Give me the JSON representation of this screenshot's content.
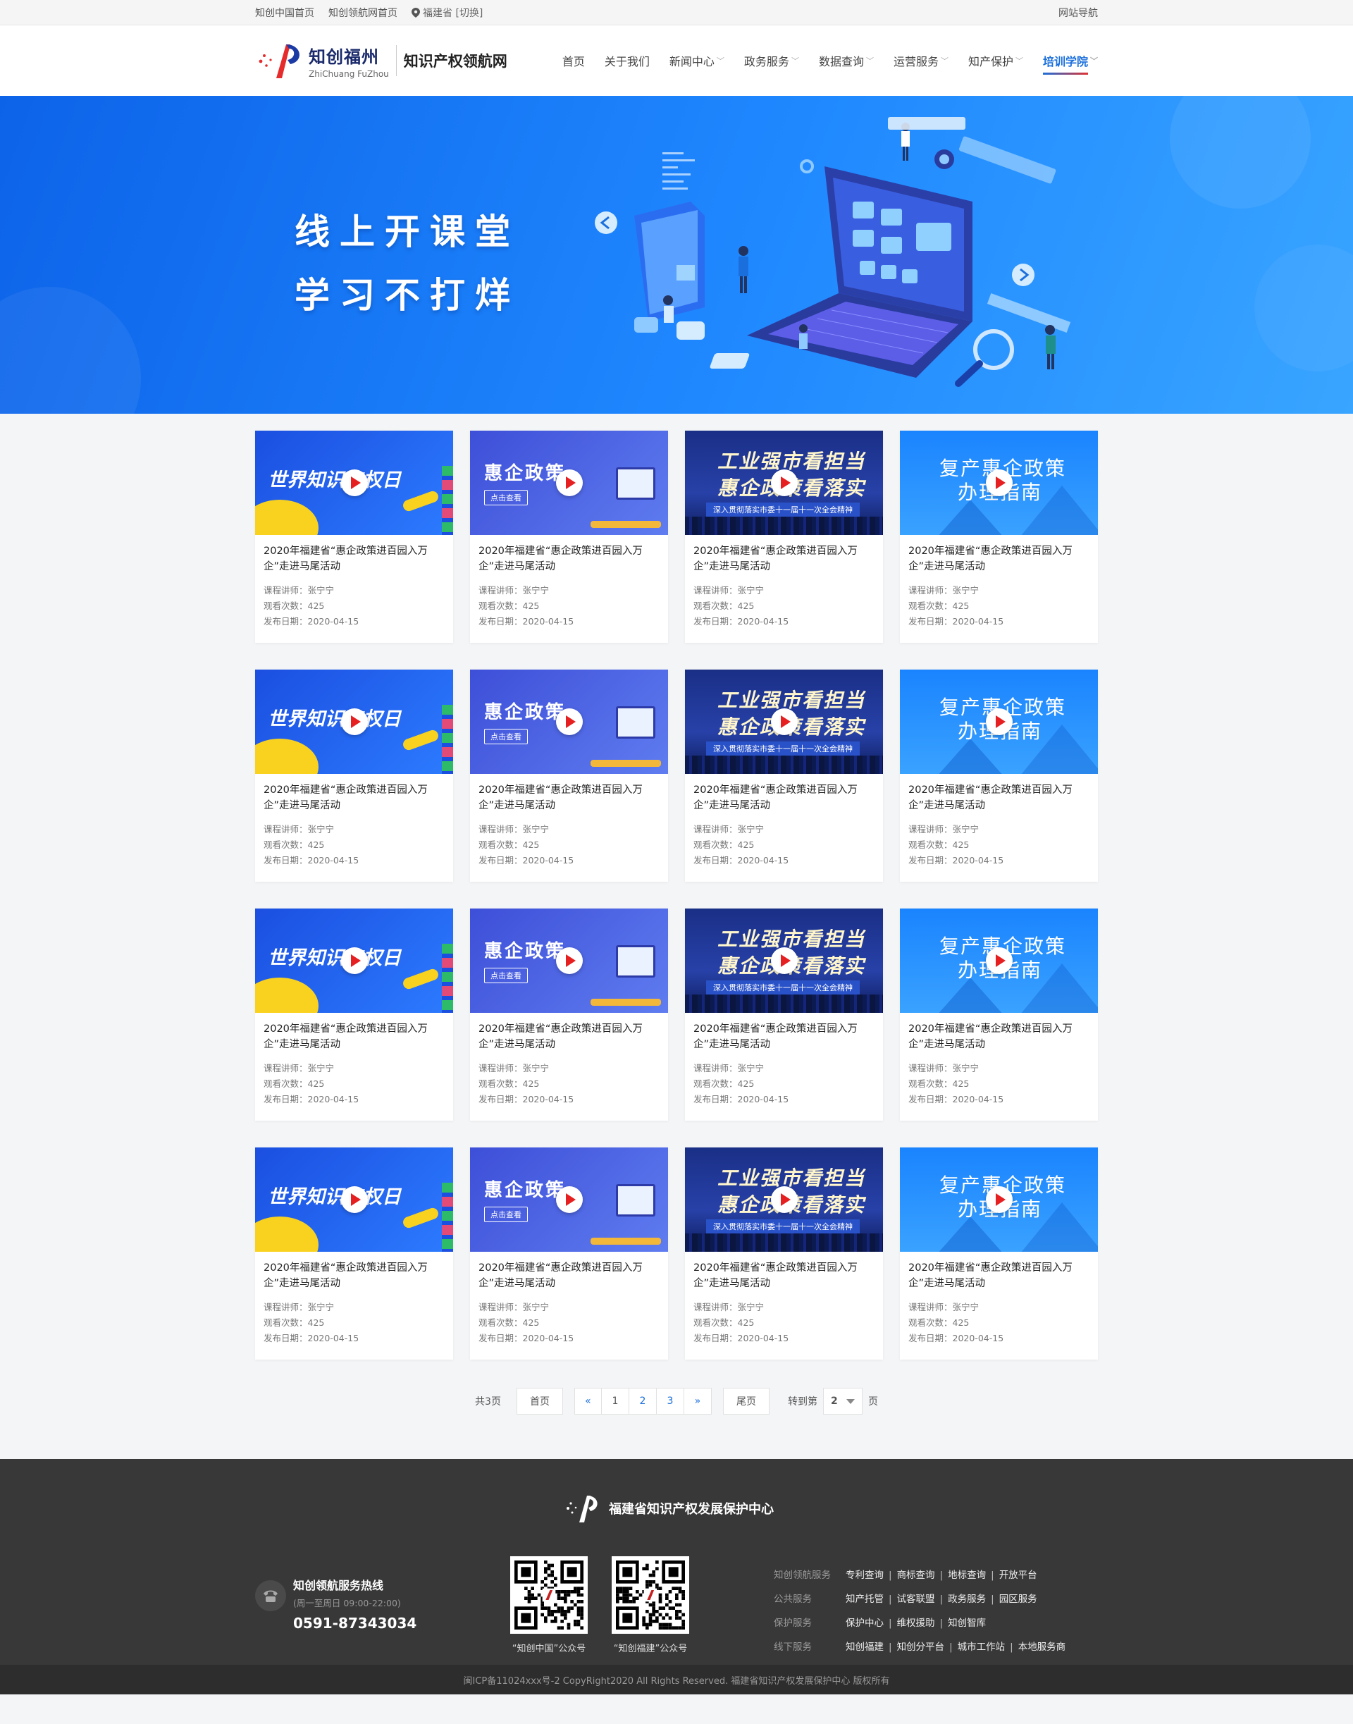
{
  "topbar": {
    "links": [
      "知创中国首页",
      "知创领航网首页"
    ],
    "location": "福建省 [切换]",
    "sitemap": "网站导航"
  },
  "header": {
    "logo_cn": "知创福州",
    "logo_en": "ZhiChuang FuZhou",
    "site_name": "知识产权领航网",
    "nav": [
      {
        "label": "首页"
      },
      {
        "label": "关于我们"
      },
      {
        "label": "新闻中心",
        "dropdown": true
      },
      {
        "label": "政务服务",
        "dropdown": true
      },
      {
        "label": "数据查询",
        "dropdown": true
      },
      {
        "label": "运营服务",
        "dropdown": true
      },
      {
        "label": "知产保护",
        "dropdown": true
      },
      {
        "label": "培训学院",
        "dropdown": true,
        "active": true
      }
    ]
  },
  "banner": {
    "line1": "线上开课堂",
    "line2": "学习不打烊"
  },
  "thumbs": {
    "t1": "世界知识产权日",
    "t2": "惠企政策",
    "t2_btn": "点击查看",
    "t3_l1": "工业强市看担当",
    "t3_l2": "惠企政策看落实",
    "t3_sub": "深入贯彻落实市委十一届十一次全会精神",
    "t4_l1": "复产惠企政策",
    "t4_l2": "办理指南"
  },
  "course": {
    "title": "2020年福建省“惠企政策进百园入万企”走进马尾活动",
    "lecturer": "课程讲师：张宁宁",
    "views": "观看次数：425",
    "date": "发布日期：2020-04-15"
  },
  "pagination": {
    "total": "共3页",
    "first": "首页",
    "prev": "«",
    "pages": [
      "1",
      "2",
      "3"
    ],
    "next": "»",
    "last": "尾页",
    "goto_prefix": "转到第",
    "goto_value": "2",
    "goto_suffix": "页"
  },
  "footer": {
    "org_name": "福建省知识产权发展保护中心",
    "hotline_title": "知创领航服务热线",
    "hotline_hours": "(周一至周日 09:00-22:00)",
    "hotline_number": "0591-87343034",
    "qr1_caption": "“知创中国”公众号",
    "qr2_caption": "“知创福建”公众号",
    "link_rows": [
      {
        "label": "知创领航服务",
        "items": [
          "专利查询",
          "商标查询",
          "地标查询",
          "开放平台"
        ]
      },
      {
        "label": "公共服务",
        "items": [
          "知产托管",
          "试客联盟",
          "政务服务",
          "园区服务"
        ]
      },
      {
        "label": "保护服务",
        "items": [
          "保护中心",
          "维权援助",
          "知创智库"
        ]
      },
      {
        "label": "线下服务",
        "items": [
          "知创福建",
          "知创分平台",
          "城市工作站",
          "本地服务商"
        ]
      }
    ],
    "copyright": "闽ICP备11024xxx号-2  CopyRight2020  All Rights Reserved.  福建省知识产权发展保护中心  版权所有"
  },
  "colors": {
    "accent": "#1a6fdc",
    "banner_blue": "#1f88ff",
    "footer_bg": "#383838"
  }
}
